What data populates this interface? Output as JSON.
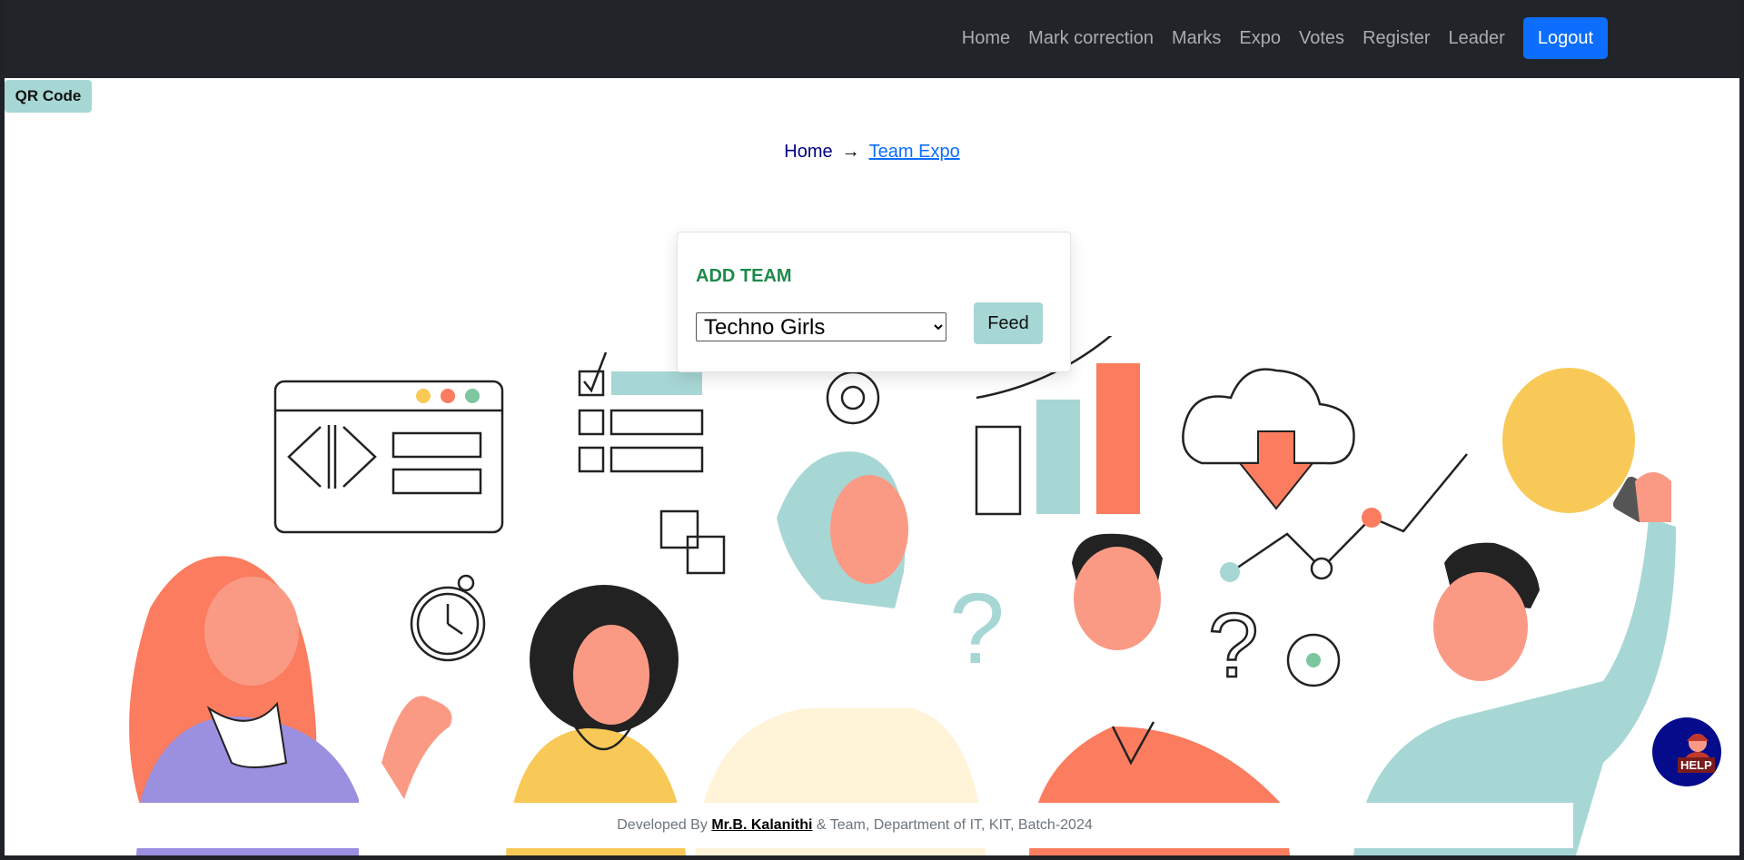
{
  "nav": {
    "items": [
      "Home",
      "Mark correction",
      "Marks",
      "Expo",
      "Votes",
      "Register",
      "Leader"
    ],
    "logout_label": "Logout"
  },
  "qr_label": "QR Code",
  "breadcrumb": {
    "home": "Home",
    "arrow": "→",
    "current": "Team Expo"
  },
  "card": {
    "title": "ADD TEAM",
    "selected_team": "Techno Girls",
    "feed_label": "Feed"
  },
  "footer": {
    "prefix": "Developed By",
    "author": "Mr.B. Kalanithi",
    "suffix": "& Team, Department of IT, KIT, Batch-2024"
  },
  "help_label": "HELP",
  "colors": {
    "navbar": "#212529",
    "logout": "#0d6efd",
    "accent_teal": "#a7d7d5",
    "title_green": "#1d8a4b",
    "coral": "#fb7c5e",
    "yellow": "#f9c957",
    "purple": "#9b8fe0"
  }
}
